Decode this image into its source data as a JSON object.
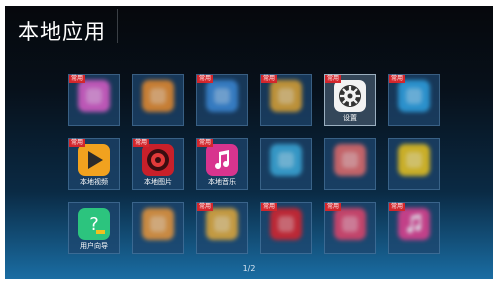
{
  "header": {
    "title": "本地应用"
  },
  "badge_label": "常用",
  "pager": {
    "text": "1/2"
  },
  "tiles": [
    {
      "label": "",
      "icon": "pink-cartoon-app-icon",
      "color": "#d85cc6",
      "badge": true,
      "focused": false
    },
    {
      "label": "",
      "icon": "orange-app-icon",
      "color": "#e58a2e",
      "badge": false,
      "focused": false
    },
    {
      "label": "",
      "icon": "game-app-icon",
      "color": "#3a86d2",
      "badge": true,
      "focused": false
    },
    {
      "label": "",
      "icon": "colorful-app-icon",
      "color": "#d8a033",
      "badge": true,
      "focused": false
    },
    {
      "label": "设置",
      "icon": "settings-gear-icon",
      "color": "#f2f2f2",
      "badge": true,
      "focused": true
    },
    {
      "label": "",
      "icon": "blue-app-icon",
      "color": "#2ea0e0",
      "badge": true,
      "focused": false
    },
    {
      "label": "本地视频",
      "icon": "play-icon",
      "color": "#f1a21f",
      "badge": true,
      "focused": false
    },
    {
      "label": "本地图片",
      "icon": "image-flower-icon",
      "color": "#c8202a",
      "badge": true,
      "focused": false
    },
    {
      "label": "本地音乐",
      "icon": "music-note-icon",
      "color": "#d8348e",
      "badge": true,
      "focused": false
    },
    {
      "label": "",
      "icon": "cyan-app-icon",
      "color": "#3aa6d6",
      "badge": false,
      "focused": false
    },
    {
      "label": "",
      "icon": "red-app-icon",
      "color": "#e06a6a",
      "badge": false,
      "focused": false
    },
    {
      "label": "",
      "icon": "yellow-chat-icon",
      "color": "#e8c21e",
      "badge": false,
      "focused": false
    },
    {
      "label": "用户向导",
      "icon": "help-question-icon",
      "color": "#2cc47e",
      "badge": false,
      "focused": false
    },
    {
      "label": "",
      "icon": "orange-circle-app-icon",
      "color": "#e7953a",
      "badge": false,
      "focused": false
    },
    {
      "label": "",
      "icon": "fruit-app-icon",
      "color": "#e0a83a",
      "badge": true,
      "focused": false
    },
    {
      "label": "",
      "icon": "red-logo-app-icon",
      "color": "#d8232c",
      "badge": true,
      "focused": false
    },
    {
      "label": "",
      "icon": "pink-app-icon",
      "color": "#e0446a",
      "badge": true,
      "focused": false
    },
    {
      "label": "",
      "icon": "pink-music-icon",
      "color": "#e0408e",
      "badge": true,
      "focused": false
    }
  ]
}
